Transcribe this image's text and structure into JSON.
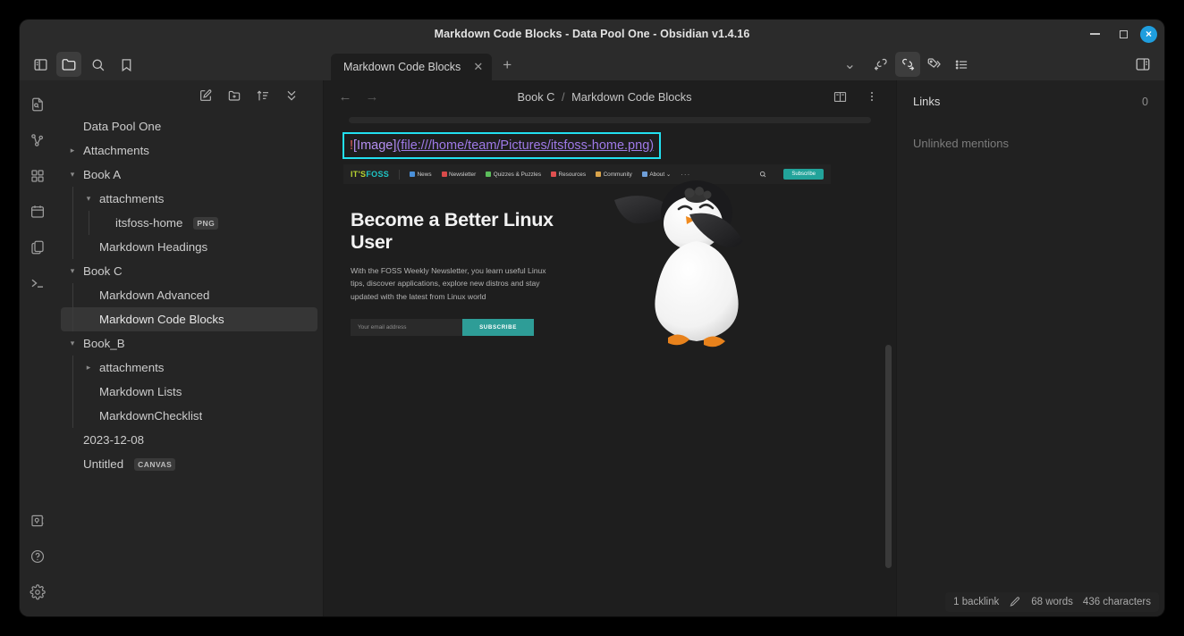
{
  "window": {
    "title": "Markdown Code Blocks - Data Pool One - Obsidian v1.4.16",
    "minimize_label": "Minimize",
    "maximize_label": "Maximize",
    "close_label": "×"
  },
  "left_toolbar": [
    {
      "name": "toggle-left-sidebar",
      "icon": "sidebar-icon",
      "active": false
    },
    {
      "name": "file-explorer",
      "icon": "folder-icon",
      "active": true
    },
    {
      "name": "search",
      "icon": "search-icon",
      "active": false
    },
    {
      "name": "bookmarks",
      "icon": "bookmark-icon",
      "active": false
    }
  ],
  "tabs": {
    "items": [
      {
        "label": "Markdown Code Blocks",
        "close": "✕",
        "active": true
      }
    ],
    "new_tab": "+",
    "tab_list_chevron": "⌄"
  },
  "right_toolbar": [
    {
      "name": "backlinks",
      "icon": "link-incoming-icon",
      "active": false
    },
    {
      "name": "outgoing-links",
      "icon": "link-outgoing-icon",
      "active": true
    },
    {
      "name": "tags",
      "icon": "tag-icon",
      "active": false
    },
    {
      "name": "outline",
      "icon": "list-icon",
      "active": false
    },
    {
      "name": "toggle-right-sidebar",
      "icon": "right-sidebar-icon",
      "active": false
    }
  ],
  "ribbon": {
    "top": [
      {
        "name": "quick-switcher",
        "icon": "file-search-icon"
      },
      {
        "name": "graph-view",
        "icon": "graph-icon"
      },
      {
        "name": "plugins",
        "icon": "grid-icon"
      },
      {
        "name": "daily-notes",
        "icon": "calendar-icon"
      },
      {
        "name": "templates",
        "icon": "copy-files-icon"
      },
      {
        "name": "terminal",
        "icon": "terminal-icon"
      }
    ],
    "bottom": [
      {
        "name": "vault-switcher",
        "icon": "vault-icon"
      },
      {
        "name": "help",
        "icon": "help-icon"
      },
      {
        "name": "settings",
        "icon": "gear-icon"
      }
    ]
  },
  "explorer": {
    "tools": [
      {
        "name": "new-note",
        "icon": "new-note-icon"
      },
      {
        "name": "new-folder",
        "icon": "new-folder-icon"
      },
      {
        "name": "change-sort-order",
        "icon": "sort-icon"
      },
      {
        "name": "collapse-all",
        "icon": "collapse-icon"
      }
    ],
    "tree": [
      {
        "label": "Data Pool One",
        "depth": 0,
        "chevron": "",
        "selected": false,
        "badge": ""
      },
      {
        "label": "Attachments",
        "depth": 0,
        "chevron": "›",
        "selected": false,
        "badge": ""
      },
      {
        "label": "Book A",
        "depth": 0,
        "chevron": "⌄",
        "selected": false,
        "badge": ""
      },
      {
        "label": "attachments",
        "depth": 1,
        "chevron": "⌄",
        "selected": false,
        "badge": ""
      },
      {
        "label": "itsfoss-home",
        "depth": 2,
        "chevron": "",
        "selected": false,
        "badge": "PNG"
      },
      {
        "label": "Markdown Headings",
        "depth": 1,
        "chevron": "",
        "selected": false,
        "badge": ""
      },
      {
        "label": "Book C",
        "depth": 0,
        "chevron": "⌄",
        "selected": false,
        "badge": ""
      },
      {
        "label": "Markdown Advanced",
        "depth": 1,
        "chevron": "",
        "selected": false,
        "badge": ""
      },
      {
        "label": "Markdown Code Blocks",
        "depth": 1,
        "chevron": "",
        "selected": true,
        "badge": ""
      },
      {
        "label": "Book_B",
        "depth": 0,
        "chevron": "⌄",
        "selected": false,
        "badge": ""
      },
      {
        "label": "attachments",
        "depth": 1,
        "chevron": "›",
        "selected": false,
        "badge": ""
      },
      {
        "label": "Markdown Lists",
        "depth": 1,
        "chevron": "",
        "selected": false,
        "badge": ""
      },
      {
        "label": "MarkdownChecklist",
        "depth": 1,
        "chevron": "",
        "selected": false,
        "badge": ""
      },
      {
        "label": "2023-12-08",
        "depth": 0,
        "chevron": "",
        "selected": false,
        "badge": ""
      },
      {
        "label": "Untitled",
        "depth": 0,
        "chevron": "",
        "selected": false,
        "badge": "CANVAS"
      }
    ]
  },
  "editor": {
    "back_arrow": "←",
    "forward_arrow": "→",
    "breadcrumb_folder": "Book C",
    "breadcrumb_separator": "/",
    "breadcrumb_file": "Markdown Code Blocks",
    "reading_view_icon": "book-icon",
    "more_options_icon": "more-vertical-icon",
    "markdown": {
      "bang": "!",
      "bracket_text": "[Image]",
      "url": "(file:///home/team/Pictures/itsfoss-home.png)",
      "selection_color": "#22e0f0"
    }
  },
  "embedded_image": {
    "alt": "itsfoss-home.png",
    "logo_part1": "IT'S",
    "logo_part2": "FOSS",
    "nav": [
      {
        "label": "News",
        "color": "#4a90d9"
      },
      {
        "label": "Newsletter",
        "color": "#d94a4a"
      },
      {
        "label": "Quizzes & Puzzles",
        "color": "#5bbd5b"
      },
      {
        "label": "Resources",
        "color": "#e05050"
      },
      {
        "label": "Community",
        "color": "#d9a34a"
      },
      {
        "label": "About ⌄",
        "color": "#6f9fd9"
      }
    ],
    "nav_more": "···",
    "search_icon": "search-icon",
    "nav_subscribe": "Subscribe",
    "hero_title": "Become a Better Linux User",
    "hero_text": "With the FOSS Weekly Newsletter, you learn useful Linux tips, discover applications, explore new distros and stay updated with the latest from Linux world",
    "email_placeholder": "Your email address",
    "subscribe_button": "SUBSCRIBE",
    "mascot": "penguin-mascot"
  },
  "right_sidebar": {
    "title": "Links",
    "count": "0",
    "unlinked_mentions": "Unlinked mentions"
  },
  "status_bar": {
    "backlinks": "1 backlink",
    "edit_icon": "pencil-icon",
    "words": "68 words",
    "characters": "436 characters"
  }
}
